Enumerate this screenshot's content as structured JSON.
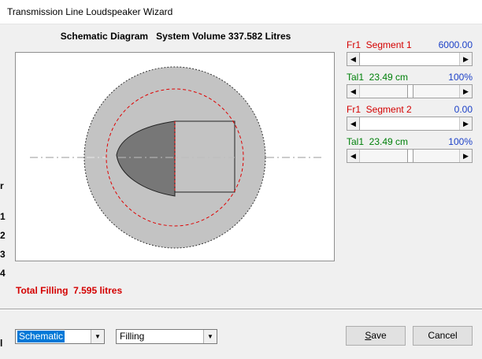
{
  "window": {
    "title": "Transmission Line Loudspeaker Wizard"
  },
  "left_clipped": [
    "r",
    "1",
    "2",
    "3",
    "4",
    "l"
  ],
  "diagram": {
    "caption": "Schematic Diagram   System Volume 337.582 Litres"
  },
  "segments": [
    {
      "label": "Fr1  Segment 1",
      "value": "6000.00",
      "label_color": "#d40000",
      "value_color": "#1a3fc7",
      "slider_pct": 100
    },
    {
      "label": "Tal1  23.49 cm",
      "value": "100%",
      "label_color": "#00800a",
      "value_color": "#1a3fc7",
      "slider_pct": 100
    },
    {
      "label": "Fr1  Segment 2",
      "value": "0.00",
      "label_color": "#d40000",
      "value_color": "#1a3fc7",
      "slider_pct": 0
    },
    {
      "label": "Tal1  23.49 cm",
      "value": "100%",
      "label_color": "#00800a",
      "value_color": "#1a3fc7",
      "slider_pct": 100
    }
  ],
  "total_filling": "Total Filling  7.595 litres",
  "view_select": {
    "value": "Schematic",
    "options": [
      "Schematic"
    ]
  },
  "mode_select": {
    "value": "Filling",
    "options": [
      "Filling"
    ]
  },
  "buttons": {
    "save": "Save",
    "cancel": "Cancel"
  },
  "icons": {
    "left_arrow": "arrow-left-icon",
    "right_arrow": "arrow-right-icon",
    "dropdown": "chevron-down-icon"
  }
}
